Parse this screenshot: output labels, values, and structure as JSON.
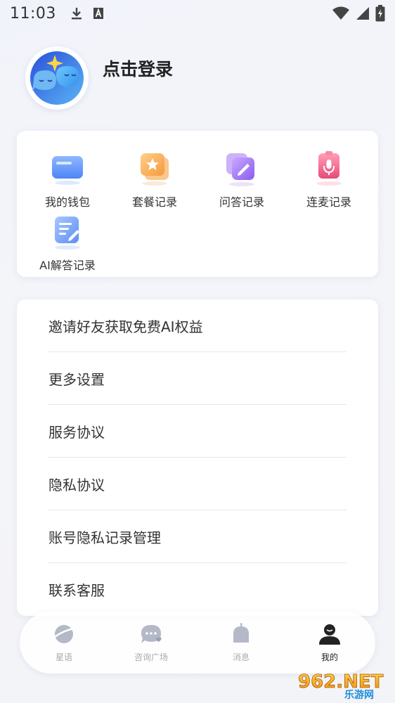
{
  "status_bar": {
    "time": "11:03",
    "icons": [
      "download-icon",
      "a-icon",
      "wifi-icon",
      "signal-icon",
      "battery-icon"
    ]
  },
  "profile": {
    "login_label": "点击登录"
  },
  "grid": {
    "items": [
      {
        "label": "我的钱包",
        "icon": "wallet-icon"
      },
      {
        "label": "套餐记录",
        "icon": "package-icon"
      },
      {
        "label": "问答记录",
        "icon": "qa-icon"
      },
      {
        "label": "连麦记录",
        "icon": "microphone-icon"
      },
      {
        "label": "AI解答记录",
        "icon": "ai-note-icon"
      }
    ]
  },
  "list": {
    "items": [
      {
        "label": "邀请好友获取免费AI权益"
      },
      {
        "label": "更多设置"
      },
      {
        "label": "服务协议"
      },
      {
        "label": "隐私协议"
      },
      {
        "label": "账号隐私记录管理"
      },
      {
        "label": "联系客服"
      }
    ]
  },
  "tabs": [
    {
      "label": "星语",
      "icon": "planet-icon",
      "active": false
    },
    {
      "label": "咨询广场",
      "icon": "chat-heart-icon",
      "active": false
    },
    {
      "label": "消息",
      "icon": "bell-icon",
      "active": false
    },
    {
      "label": "我的",
      "icon": "user-icon",
      "active": true
    }
  ],
  "watermark": {
    "text": "962.NET",
    "subtext": "乐游网"
  },
  "colors": {
    "accent_blue": "#4a8df0",
    "tab_active": "#222222",
    "tab_inactive": "#aaaaaa"
  }
}
